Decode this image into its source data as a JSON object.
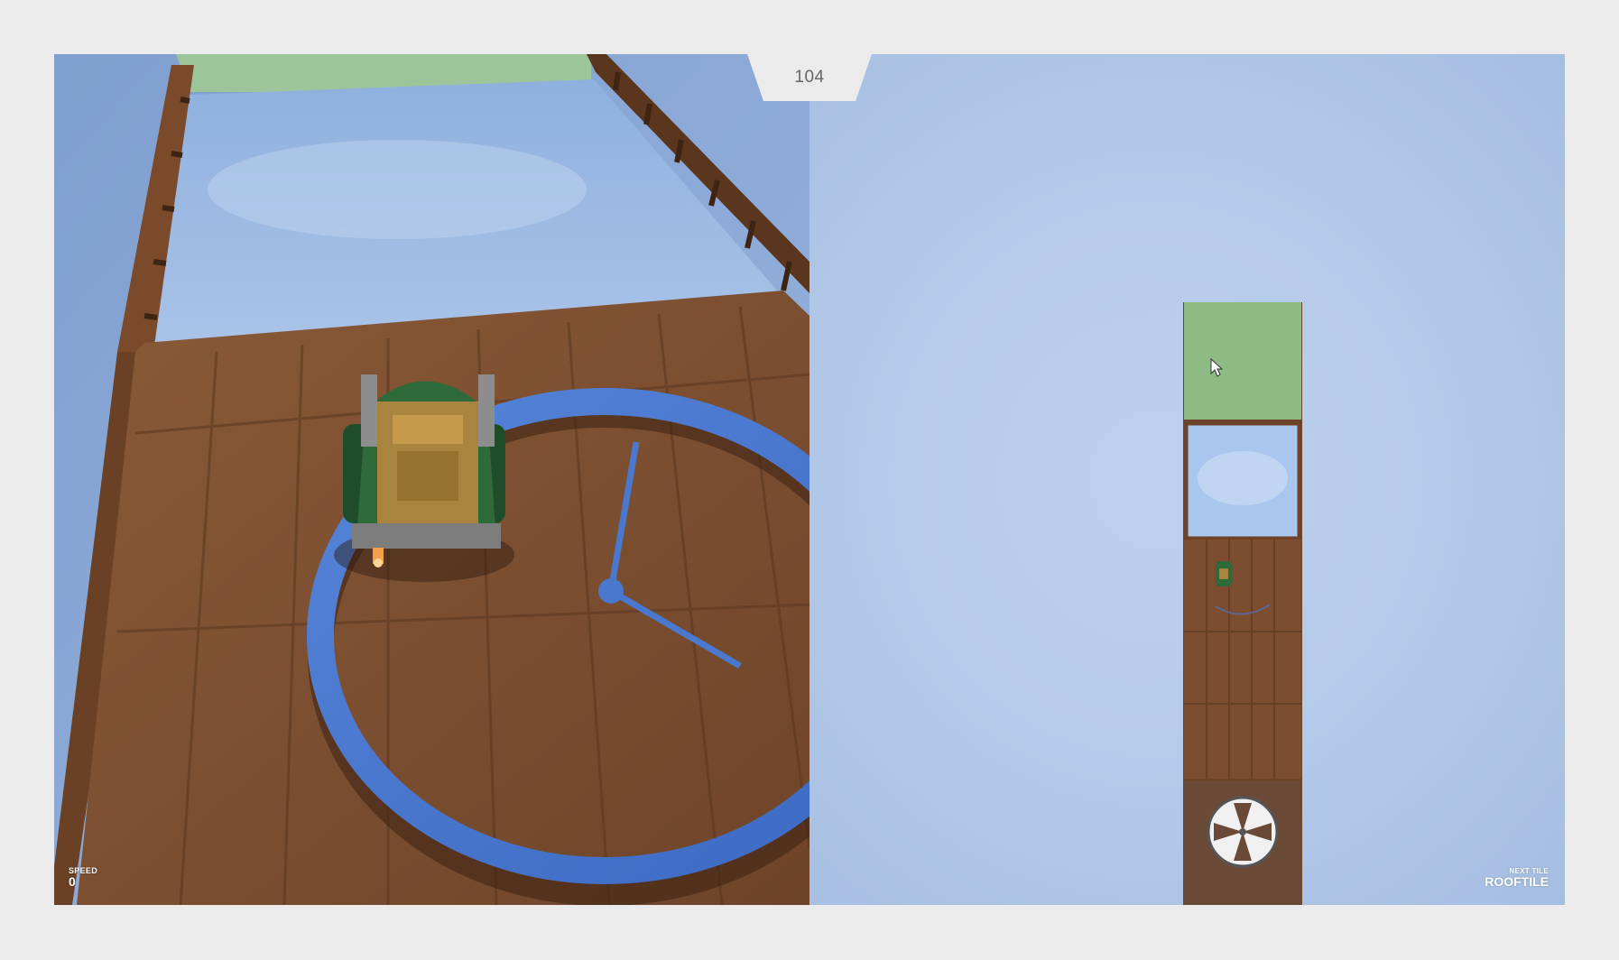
{
  "hud": {
    "counter": "104",
    "speed_label": "SPEED",
    "speed_value": "0",
    "next_tile_label": "NEXT TILE",
    "next_tile_value": "ROOFTILE"
  },
  "colors": {
    "background": "#ebebeb",
    "sky": "#b3c8e6",
    "wood": "#7a4f31",
    "goal_tile": "#8ebb84",
    "track_ring": "#4a78cf",
    "truck_body": "#2e6a3a",
    "truck_cargo": "#a8843f"
  },
  "icons": {
    "cursor": "mouse-pointer-icon",
    "fan": "fan-icon"
  }
}
